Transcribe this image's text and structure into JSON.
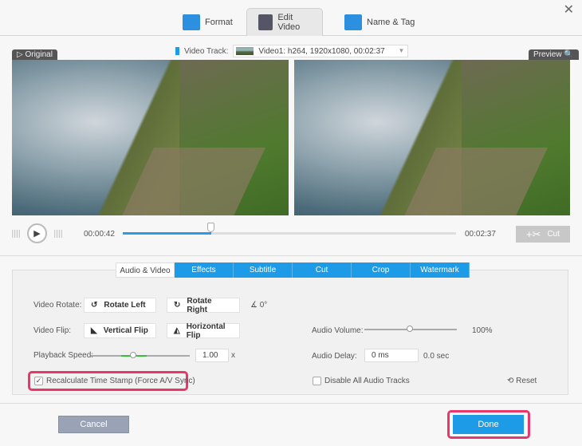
{
  "top_tabs": [
    {
      "label": "Format"
    },
    {
      "label": "Edit Video"
    },
    {
      "label": "Name & Tag"
    }
  ],
  "video_track": {
    "label": "Video Track:",
    "value": "Video1: h264, 1920x1080, 00:02:37"
  },
  "original_label": "Original",
  "preview_label": "Preview",
  "player": {
    "current_time": "00:00:42",
    "total_time": "00:02:37",
    "progress_percent": 27,
    "cut_label": "Cut"
  },
  "sub_tabs": [
    {
      "label": "Audio & Video"
    },
    {
      "label": "Effects"
    },
    {
      "label": "Subtitle"
    },
    {
      "label": "Cut"
    },
    {
      "label": "Crop"
    },
    {
      "label": "Watermark"
    }
  ],
  "settings": {
    "rotate_label": "Video Rotate:",
    "rotate_left": "Rotate Left",
    "rotate_right": "Rotate Right",
    "rotate_angle": "0°",
    "flip_label": "Video Flip:",
    "vertical_flip": "Vertical Flip",
    "horizontal_flip": "Horizontal Flip",
    "speed_label": "Playback Speed:",
    "speed_value": "1.00",
    "speed_unit": "x",
    "volume_label": "Audio Volume:",
    "volume_value": "100%",
    "delay_label": "Audio Delay:",
    "delay_value": "0 ms",
    "delay_sec": "0.0 sec",
    "recalc_label": "Recalculate Time Stamp (Force A/V Sync)",
    "recalc_checked": true,
    "disable_audio_label": "Disable All Audio Tracks",
    "reset_label": "Reset"
  },
  "footer": {
    "cancel": "Cancel",
    "done": "Done"
  },
  "colors": {
    "accent": "#1e9be6",
    "highlight": "#e8386a"
  }
}
